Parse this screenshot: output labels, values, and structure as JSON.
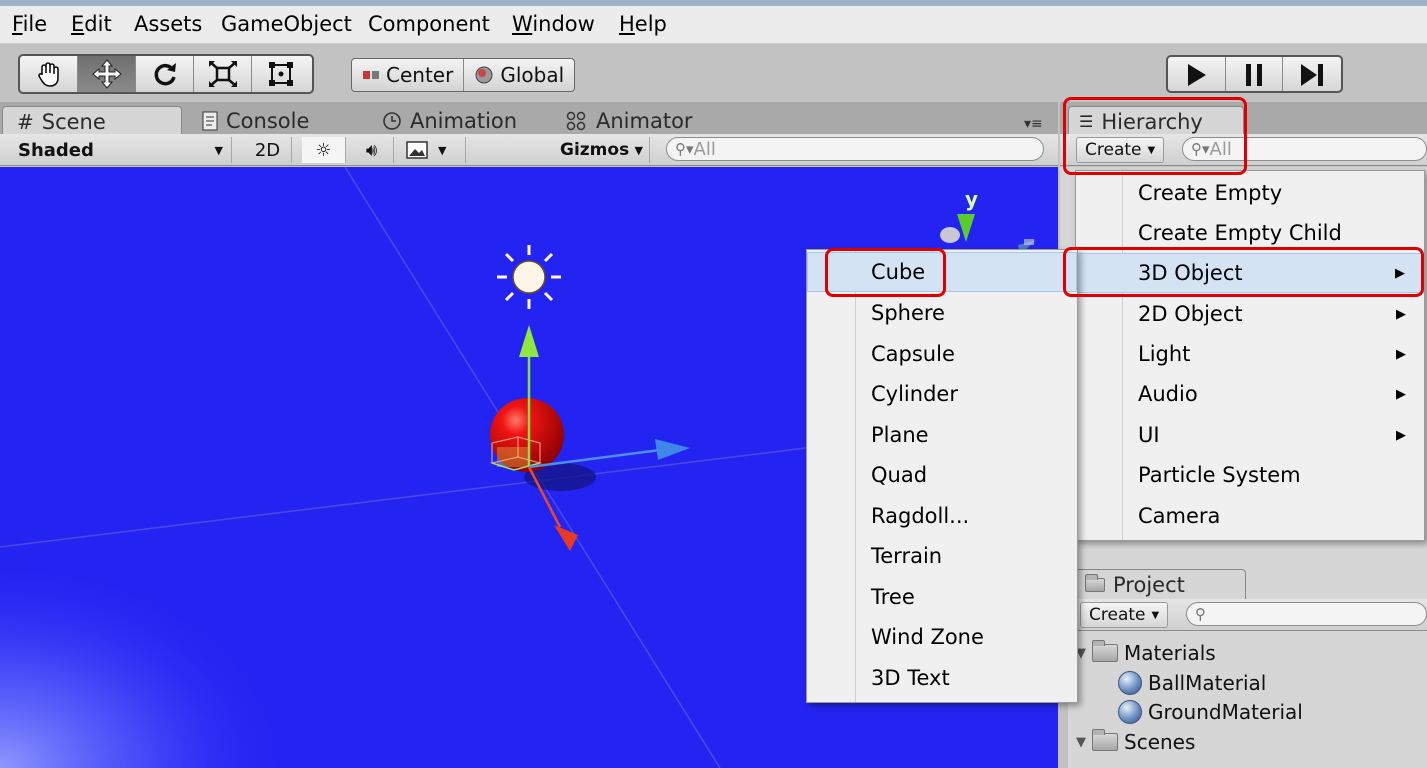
{
  "menubar": {
    "items": [
      {
        "pre": "",
        "u": "F",
        "post": "ile"
      },
      {
        "pre": "",
        "u": "E",
        "post": "dit"
      },
      {
        "pre": "Assets",
        "u": "",
        "post": ""
      },
      {
        "pre": "GameObject",
        "u": "",
        "post": ""
      },
      {
        "pre": "Component",
        "u": "",
        "post": ""
      },
      {
        "pre": "",
        "u": "W",
        "post": "indow"
      },
      {
        "pre": "",
        "u": "H",
        "post": "elp"
      }
    ]
  },
  "toolbar": {
    "tools": [
      "hand-icon",
      "move-icon",
      "rotate-icon",
      "scale-icon",
      "rect-icon"
    ],
    "active_tool": "move-icon",
    "pivot_label": "Center",
    "space_label": "Global",
    "playback": [
      "play-icon",
      "pause-icon",
      "step-icon"
    ]
  },
  "scene_tabs": {
    "scene": "Scene",
    "console": "Console",
    "animation": "Animation",
    "animator": "Animator"
  },
  "scene_toolbar": {
    "shading": "Shaded",
    "mode_2d": "2D",
    "gizmos": "Gizmos",
    "search": "All"
  },
  "gizmo": {
    "axis_label": "y"
  },
  "hierarchy": {
    "title": "Hierarchy",
    "create_label": "Create",
    "search": "All"
  },
  "create_menu": {
    "items": [
      {
        "label": "Create Empty",
        "submenu": false
      },
      {
        "label": "Create Empty Child",
        "submenu": false
      },
      {
        "label": "3D Object",
        "submenu": true
      },
      {
        "label": "2D Object",
        "submenu": true
      },
      {
        "label": "Light",
        "submenu": true
      },
      {
        "label": "Audio",
        "submenu": true
      },
      {
        "label": "UI",
        "submenu": true
      },
      {
        "label": "Particle System",
        "submenu": false
      },
      {
        "label": "Camera",
        "submenu": false
      }
    ],
    "highlighted": "3D Object"
  },
  "submenu_3d": {
    "items": [
      "Cube",
      "Sphere",
      "Capsule",
      "Cylinder",
      "Plane",
      "Quad",
      "Ragdoll...",
      "Terrain",
      "Tree",
      "Wind Zone",
      "3D Text"
    ],
    "highlighted": "Cube"
  },
  "project": {
    "title": "Project",
    "create_label": "Create",
    "tree": [
      {
        "label": "Materials",
        "type": "folder"
      },
      {
        "label": "BallMaterial",
        "type": "material"
      },
      {
        "label": "GroundMaterial",
        "type": "material"
      },
      {
        "label": "Scenes",
        "type": "folder"
      }
    ]
  },
  "colors": {
    "scene_background": "#2424f2",
    "highlight_box": "#e00000",
    "menu_highlight": "#d3e3f4"
  }
}
